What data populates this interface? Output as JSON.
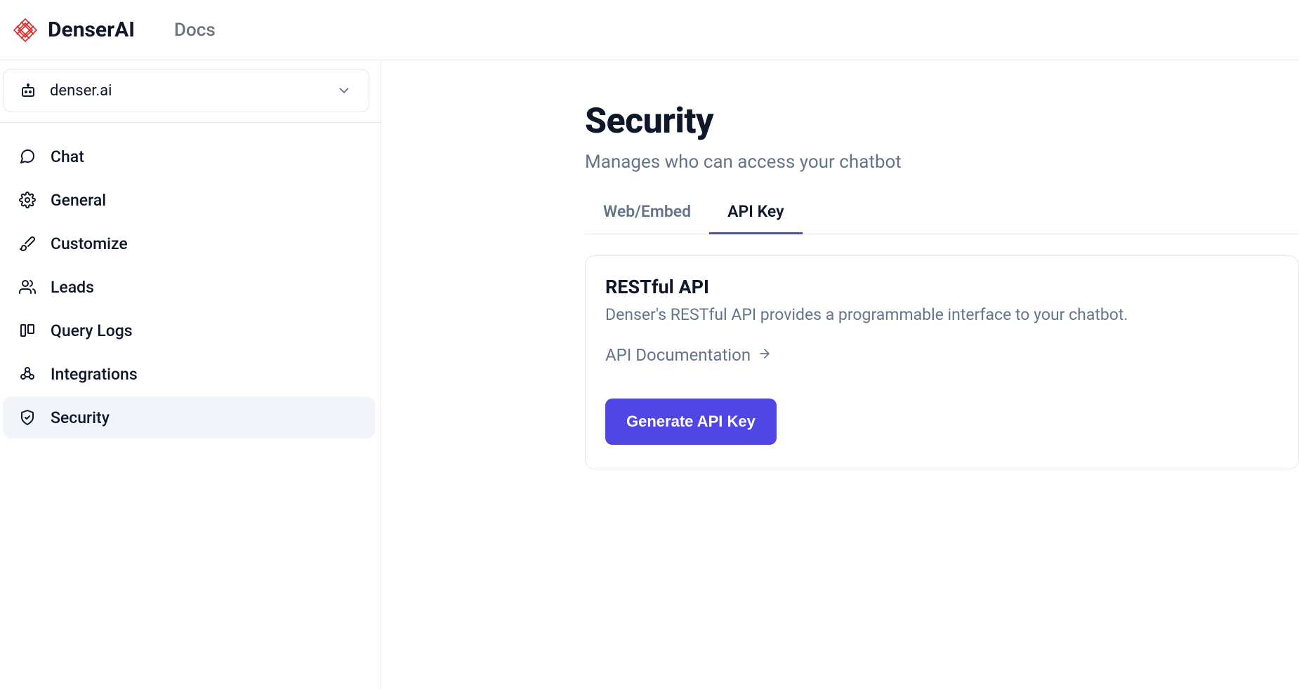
{
  "header": {
    "brand": "DenserAI",
    "nav_docs": "Docs"
  },
  "selector": {
    "value": "denser.ai"
  },
  "sidebar": {
    "items": [
      {
        "label": "Chat"
      },
      {
        "label": "General"
      },
      {
        "label": "Customize"
      },
      {
        "label": "Leads"
      },
      {
        "label": "Query Logs"
      },
      {
        "label": "Integrations"
      },
      {
        "label": "Security"
      }
    ]
  },
  "main": {
    "title": "Security",
    "subtitle": "Manages who can access your chatbot",
    "tabs": [
      {
        "label": "Web/Embed"
      },
      {
        "label": "API Key"
      }
    ],
    "card": {
      "title": "RESTful API",
      "description": "Denser's RESTful API provides a programmable interface to your chatbot.",
      "doc_link_label": "API Documentation",
      "generate_button": "Generate API Key"
    }
  }
}
